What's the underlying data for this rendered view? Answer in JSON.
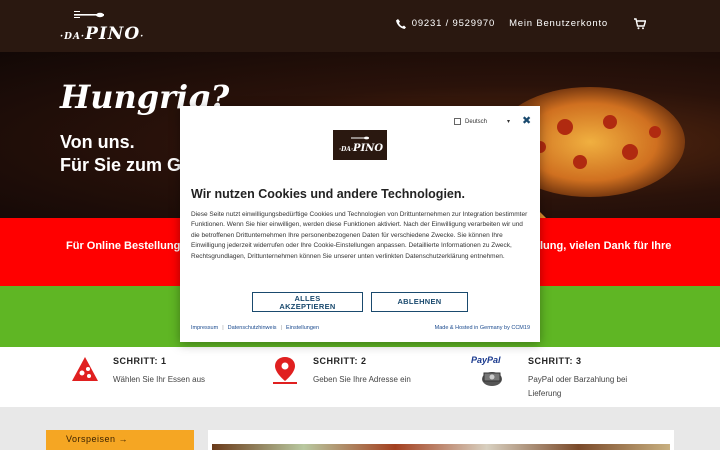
{
  "header": {
    "logo_top": "·DA·",
    "logo_word": "PINO",
    "phone": "09231 / 9529970",
    "account": "Mein Benutzerkonto"
  },
  "hero": {
    "headline": "Hungrig?",
    "line1": "Von uns.",
    "line2": "Für Sie zum Ge"
  },
  "band": {
    "left_text": "Für Online Bestellungen",
    "right_text": "lung, vielen Dank für Ihre"
  },
  "steps": [
    {
      "title": "SCHRITT: 1",
      "text": "Wählen Sie Ihr Essen aus"
    },
    {
      "title": "SCHRITT: 2",
      "text": "Geben Sie Ihre Adresse ein"
    },
    {
      "title": "SCHRITT: 3",
      "text1": "PayPal oder Barzahlung bei",
      "text2": "Lieferung"
    }
  ],
  "paypal_label": "PayPal",
  "menu": {
    "category": "Vorspeisen"
  },
  "cookie": {
    "language": "Deutsch",
    "title": "Wir nutzen Cookies und andere Technologien.",
    "body": "Diese Seite nutzt einwilligungsbedürftige Cookies und Technologien von Drittunternehmen zur Integration bestimmter Funktionen. Wenn Sie hier einwilligen, werden diese Funktionen aktiviert. Nach der Einwilligung verarbeiten wir und die betroffenen Drittunternehmen Ihre personenbezogenen Daten für verschiedene Zwecke. Sie können Ihre Einwilligung jederzeit widerrufen oder Ihre Cookie-Einstellungen anpassen. Detaillierte Informationen zu Zweck, Rechtsgrundlagen, Drittunternehmen können Sie unserer unten verlinkten Datenschutzerklärung entnehmen.",
    "accept_line1": "ALLES",
    "accept_line2": "AKZEPTIEREN",
    "decline": "ABLEHNEN",
    "link_impressum": "Impressum",
    "link_datenschutz": "Datenschutzhinweis",
    "link_einstellungen": "Einstellungen",
    "hosted": "Made & Hosted in Germany by CCM19"
  },
  "colors": {
    "header_bg": "#2a1810",
    "red_band": "#ff0000",
    "green_band": "#5fb624",
    "accent_orange": "#f5a623",
    "button_blue": "#1a4a6e"
  }
}
